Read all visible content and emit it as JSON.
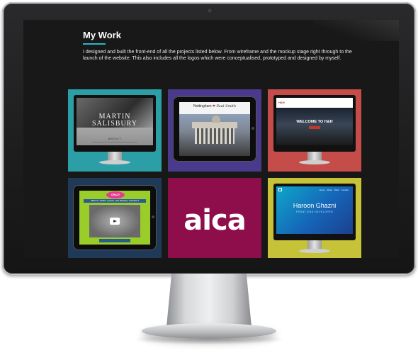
{
  "page": {
    "title": "My Work",
    "intro": "I designed and built the front-end of all the projects listed below. From wireframe and the mockup stage right through to the launch of the website. This also includes all the logos which were conceptualised, prototyped and designed by myself.",
    "accent_color": "#2ab5c9"
  },
  "projects": [
    {
      "name": "MARTIN SALISBURY",
      "caption": "ABOUT",
      "device": "desktop",
      "color": "#2c9ea5"
    },
    {
      "name": "Nottingham",
      "signature": "Paul Smith",
      "device": "tablet",
      "color": "#4a3a8c"
    },
    {
      "name": "WELCOME TO H&H",
      "logo": "H&H",
      "device": "desktop",
      "color": "#c44d4a"
    },
    {
      "name": "CRAZY CRICKET",
      "nav": "ABOUT | VIDEO | QUIZ | THE BADGE | CONTACT",
      "device": "tablet",
      "color": "#1f3a59"
    },
    {
      "name": "aica",
      "device": "logo",
      "color": "#8e0e4c"
    },
    {
      "name": "Haroon Ghazni",
      "subtitle": "FRONT-END DEVELOPER",
      "nav": "Home About Work Contact",
      "device": "desktop",
      "color": "#c7c338"
    }
  ]
}
